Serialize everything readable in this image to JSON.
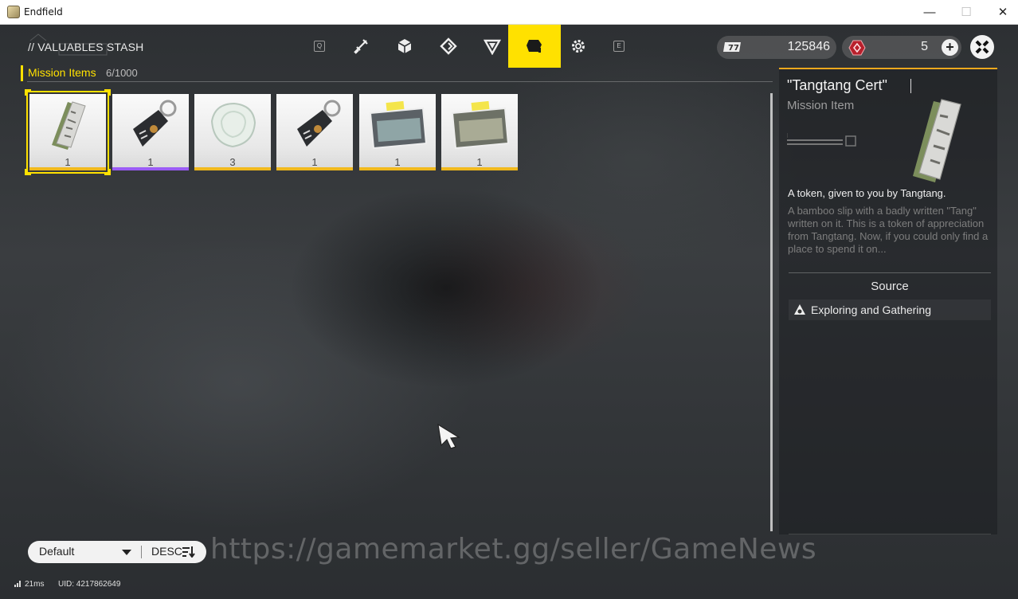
{
  "window": {
    "title": "Endfield",
    "minimize": "—",
    "maximize": "☐",
    "close": "✕"
  },
  "header": {
    "title": "// VALUABLES STASH",
    "tabs": [
      {
        "icon": "weapon-icon"
      },
      {
        "icon": "cube-icon"
      },
      {
        "icon": "diamond-icon"
      },
      {
        "icon": "triangle-icon"
      },
      {
        "icon": "mission-item-icon",
        "active": true
      },
      {
        "icon": "gear-icon"
      }
    ],
    "key_left": "Q",
    "key_right": "E",
    "currency_1": {
      "icon": "ticket-icon",
      "value": "125846"
    },
    "currency_2": {
      "icon": "originium-icon",
      "value": "5",
      "add": "+"
    }
  },
  "category": {
    "label": "Mission Items",
    "count": "6/1000"
  },
  "items": [
    {
      "name": "Tangtang Cert",
      "qty": "1",
      "rarity": "gold",
      "icon": "bamboo-slip-icon",
      "selected": true
    },
    {
      "name": "Keychain Tag",
      "qty": "1",
      "rarity": "purple",
      "icon": "tag-icon"
    },
    {
      "name": "Crystal",
      "qty": "3",
      "rarity": "gold",
      "icon": "crystal-icon"
    },
    {
      "name": "Keychain Tag",
      "qty": "1",
      "rarity": "gold",
      "icon": "tag-icon"
    },
    {
      "name": "Photo",
      "qty": "1",
      "rarity": "gold",
      "icon": "photo-icon"
    },
    {
      "name": "Photo",
      "qty": "1",
      "rarity": "gold",
      "icon": "photo-icon"
    }
  ],
  "detail": {
    "title": "\"Tangtang Cert\"",
    "type": "Mission Item",
    "subtitle": "A token, given to you by Tangtang.",
    "description": "A bamboo slip with a badly written \"Tang\" written on it. This is a token of appreciation from Tangtang. Now, if you could only find a place to spend it on...",
    "source_heading": "Source",
    "source": "Exploring and Gathering"
  },
  "sort": {
    "order": "Default",
    "direction": "DESC"
  },
  "watermark": "https://gamemarket.gg/seller/GameNews",
  "status": {
    "ping": "21ms",
    "uid": "UID: 4217862649"
  },
  "colors": {
    "accent": "#ffe100",
    "rarity_gold": "#f1b91d",
    "rarity_purple": "#9b5cf5"
  }
}
